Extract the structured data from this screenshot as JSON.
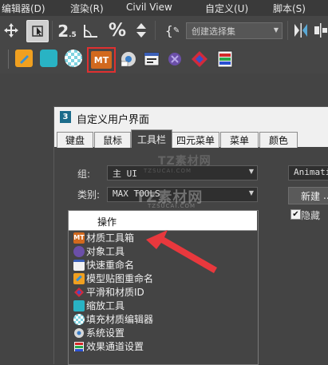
{
  "menubar": {
    "items": [
      {
        "label": "编辑器(D)"
      },
      {
        "label": "渲染(R)"
      },
      {
        "label": "Civil View"
      },
      {
        "label": "自定义(U)"
      },
      {
        "label": "脚本(S)"
      }
    ]
  },
  "toolbar": {
    "selection_set_placeholder": "创建选择集",
    "mt_label": "MT"
  },
  "dialog": {
    "app_badge": "3",
    "title": "自定义用户界面",
    "tabs": [
      {
        "label": "键盘"
      },
      {
        "label": "鼠标"
      },
      {
        "label": "工具栏"
      },
      {
        "label": "四元菜单"
      },
      {
        "label": "菜单"
      },
      {
        "label": "颜色"
      }
    ],
    "active_tab": "工具栏",
    "group_label": "组:",
    "group_value": "主 UI",
    "category_label": "类别:",
    "category_value": "MAX TOOLS",
    "actions_header": "操作",
    "actions": [
      {
        "label": "材质工具箱",
        "icon": "mt-icon"
      },
      {
        "label": "对象工具",
        "icon": "object-tools-icon"
      },
      {
        "label": "快速重命名",
        "icon": "quick-rename-icon"
      },
      {
        "label": "模型贴图重命名",
        "icon": "model-map-rename-icon"
      },
      {
        "label": "平滑和材质ID",
        "icon": "smooth-material-id-icon"
      },
      {
        "label": "缩放工具",
        "icon": "scale-tool-icon"
      },
      {
        "label": "填充材质编辑器",
        "icon": "fill-material-editor-icon"
      },
      {
        "label": "系统设置",
        "icon": "system-settings-icon"
      },
      {
        "label": "效果通道设置",
        "icon": "effect-channel-icon"
      }
    ],
    "right_combo_value": "Animati",
    "new_button_label": "新建",
    "hide_checkbox_label": "隐藏",
    "hide_checked": true
  },
  "watermark": {
    "text1": "TZ素材网",
    "sub1": "TZSUCAI.COM",
    "text2": "TZ素材网",
    "sub2": "TZSUCAI.COM"
  },
  "colors": {
    "highlight_box": "#e03030",
    "arrow": "#e8383d"
  }
}
